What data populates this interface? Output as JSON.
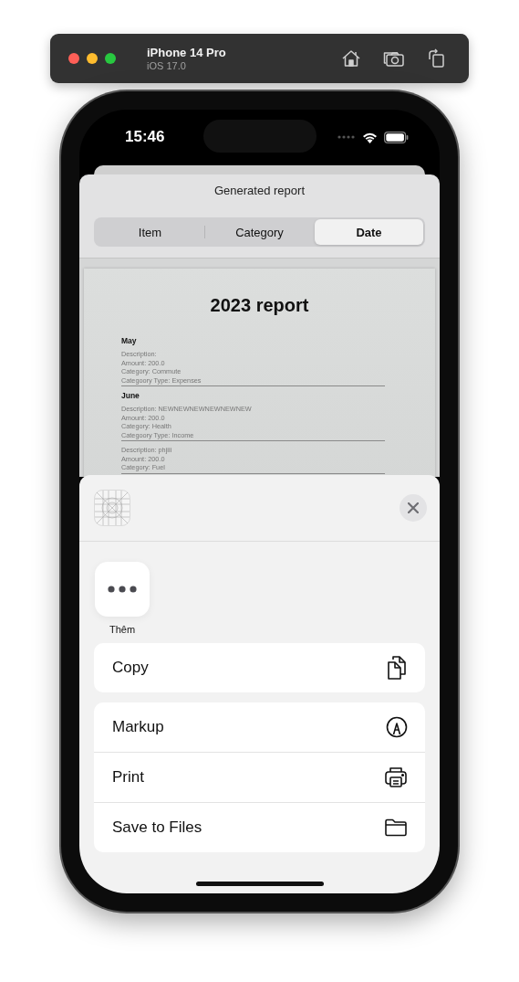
{
  "simulator": {
    "device": "iPhone 14 Pro",
    "os": "iOS 17.0"
  },
  "status_bar": {
    "time": "15:46"
  },
  "sheet": {
    "title": "Generated report",
    "segments": [
      {
        "label": "Item",
        "selected": false
      },
      {
        "label": "Category",
        "selected": false
      },
      {
        "label": "Date",
        "selected": true
      }
    ]
  },
  "report": {
    "title": "2023 report",
    "sections": [
      {
        "heading": "May",
        "entries": [
          {
            "lines": [
              "Description:",
              "Amount: 200.0",
              "Category: Commute",
              "Categoory Type: Expenses"
            ]
          }
        ]
      },
      {
        "heading": "June",
        "entries": [
          {
            "lines": [
              "Description: NEWNEWNEWNEWNEWNEW",
              "Amount: 200.0",
              "Category: Health",
              "Categoory Type: Income"
            ]
          },
          {
            "lines": [
              "Description: phjiii",
              "Amount: 200.0",
              "Category: Fuel"
            ]
          }
        ]
      }
    ]
  },
  "share_sheet": {
    "apps": [
      {
        "label": "Thêm"
      }
    ],
    "action_groups": [
      [
        {
          "label": "Copy",
          "kind": "copy"
        }
      ],
      [
        {
          "label": "Markup",
          "kind": "markup"
        },
        {
          "label": "Print",
          "kind": "print"
        },
        {
          "label": "Save to Files",
          "kind": "folder"
        }
      ]
    ]
  }
}
